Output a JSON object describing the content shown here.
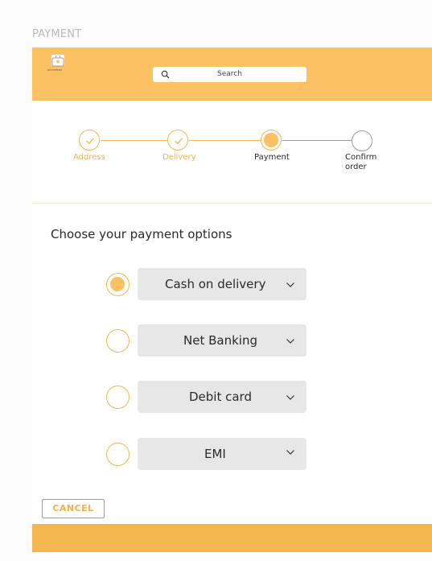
{
  "frame_title": "PAYMENT",
  "header": {
    "logo_text": "PAYTOMEPR",
    "search_placeholder": "Search"
  },
  "steps": [
    {
      "label": "Address",
      "state": "done"
    },
    {
      "label": "Delivery",
      "state": "done"
    },
    {
      "label": "Payment",
      "state": "active"
    },
    {
      "label": "Confirm order",
      "state": "pending"
    }
  ],
  "heading": "Choose your payment options",
  "options": [
    {
      "label": "Cash on delivery",
      "selected": true
    },
    {
      "label": "Net Banking",
      "selected": false
    },
    {
      "label": "Debit card",
      "selected": false
    },
    {
      "label": "EMI",
      "selected": false
    }
  ],
  "cancel_label": "CANCEL",
  "colors": {
    "accent": "#fbc163",
    "accent_dark": "#f4b64e",
    "option_bg": "#e7e7e7"
  }
}
